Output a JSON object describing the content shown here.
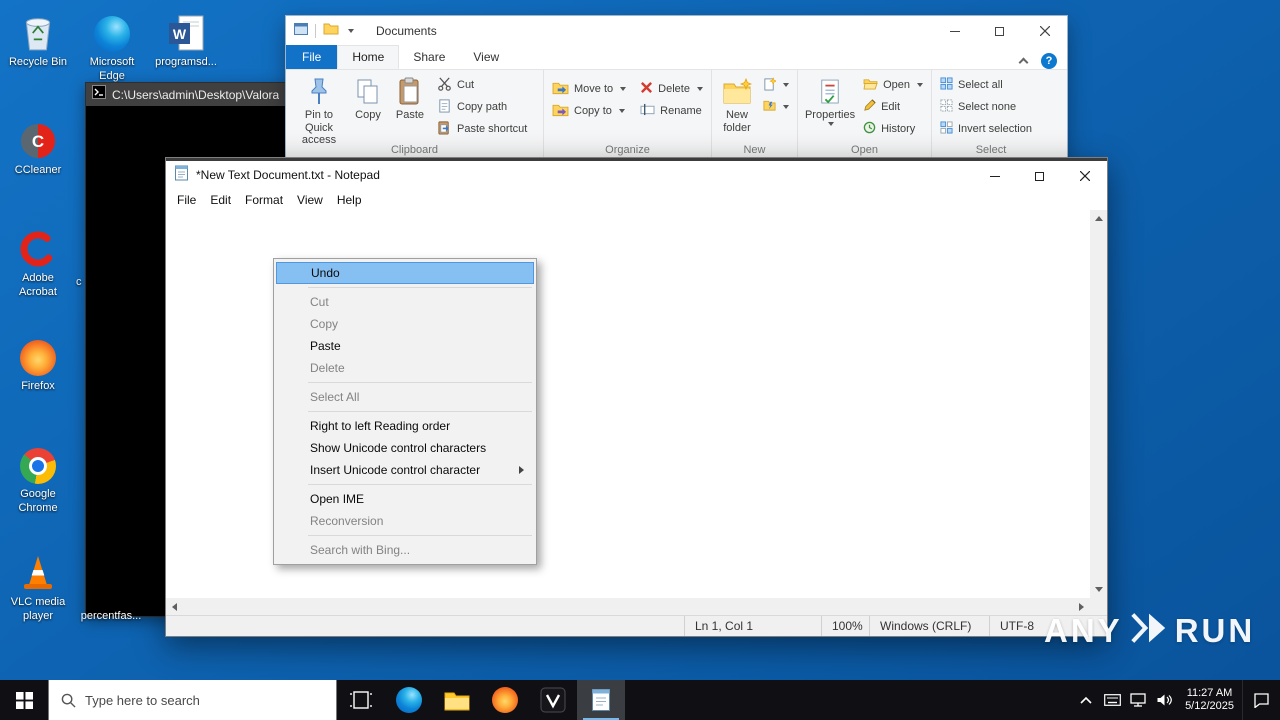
{
  "desktop": {
    "icons": [
      {
        "label": "Recycle Bin"
      },
      {
        "label": "Microsoft Edge"
      },
      {
        "label": "programsd..."
      },
      {
        "label": "CCleaner"
      },
      {
        "label": "Adobe Acrobat"
      },
      {
        "label": "Firefox"
      },
      {
        "label": "Google Chrome"
      },
      {
        "label": "VLC media player"
      },
      {
        "label": "percentfas..."
      }
    ],
    "clipped_label": "c"
  },
  "cmd": {
    "title": "C:\\Users\\admin\\Desktop\\Valora"
  },
  "explorer": {
    "title": "Documents",
    "tabs": [
      "File",
      "Home",
      "Share",
      "View"
    ],
    "help_label": "?",
    "ribbon": {
      "clipboard": {
        "label": "Clipboard",
        "pin": "Pin to Quick access",
        "copy": "Copy",
        "paste": "Paste",
        "cut": "Cut",
        "copy_path": "Copy path",
        "paste_shortcut": "Paste shortcut"
      },
      "organize": {
        "label": "Organize",
        "move_to": "Move to",
        "copy_to": "Copy to",
        "delete": "Delete",
        "rename": "Rename"
      },
      "new_group": {
        "label": "New",
        "new_folder": "New folder"
      },
      "open_group": {
        "label": "Open",
        "properties": "Properties",
        "open": "Open",
        "edit": "Edit",
        "history": "History"
      },
      "select_group": {
        "label": "Select",
        "select_all": "Select all",
        "select_none": "Select none",
        "invert": "Invert selection"
      }
    }
  },
  "notepad": {
    "title": "*New Text Document.txt - Notepad",
    "menu": [
      "File",
      "Edit",
      "Format",
      "View",
      "Help"
    ],
    "context_menu": [
      {
        "label": "Undo",
        "state": "selected"
      },
      {
        "label": "Cut",
        "state": "disabled"
      },
      {
        "label": "Copy",
        "state": "disabled"
      },
      {
        "label": "Paste",
        "state": "enabled"
      },
      {
        "label": "Delete",
        "state": "disabled"
      },
      {
        "label": "Select All",
        "state": "disabled"
      },
      {
        "label": "Right to left Reading order",
        "state": "enabled"
      },
      {
        "label": "Show Unicode control characters",
        "state": "enabled"
      },
      {
        "label": "Insert Unicode control character",
        "state": "enabled",
        "has_submenu": true
      },
      {
        "label": "Open IME",
        "state": "enabled"
      },
      {
        "label": "Reconversion",
        "state": "disabled"
      },
      {
        "label": "Search with Bing...",
        "state": "disabled"
      }
    ],
    "statusbar": {
      "cursor": "Ln 1, Col 1",
      "zoom": "100%",
      "line_ending": "Windows (CRLF)",
      "encoding": "UTF-8"
    }
  },
  "taskbar": {
    "search_placeholder": "Type here to search",
    "clock": {
      "time": "11:27 AM",
      "date": "5/12/2025"
    }
  },
  "watermark": {
    "left": "ANY",
    "right": "RUN"
  }
}
